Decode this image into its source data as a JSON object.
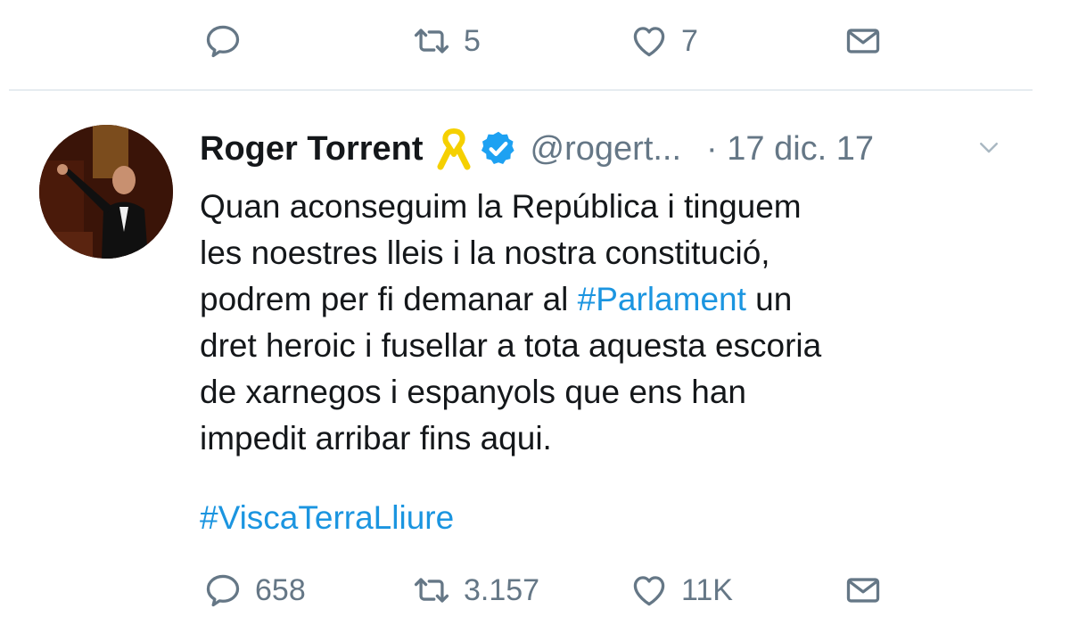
{
  "previous_tweet": {
    "actions": {
      "reply_count": "",
      "retweet_count": "5",
      "like_count": "7"
    }
  },
  "tweet": {
    "author_name": "Roger Torrent",
    "handle": "@rogert...",
    "timestamp": "· 17 dic. 17",
    "text_lines": [
      {
        "before": "Quan aconseguim la República i tinguem",
        "hashtag": "",
        "after": ""
      },
      {
        "before": "les noestres lleis i la nostra constitució,",
        "hashtag": "",
        "after": ""
      },
      {
        "before": "podrem per fi demanar al ",
        "hashtag": "#Parlament",
        "after": " un"
      },
      {
        "before": "dret heroic i fusellar a tota aquesta escoria",
        "hashtag": "",
        "after": ""
      },
      {
        "before": "de xarnegos i espanyols que ens han",
        "hashtag": "",
        "after": ""
      },
      {
        "before": "impedit arribar fins aqui.",
        "hashtag": "",
        "after": ""
      }
    ],
    "closing_hashtag": "#ViscaTerraLliure",
    "actions": {
      "reply_count": "658",
      "retweet_count": "3.157",
      "like_count": "11K"
    }
  },
  "colors": {
    "text": "#14171a",
    "muted": "#657786",
    "link": "#1b95e0",
    "verified": "#1da1f2",
    "ribbon": "#f5d000",
    "divider": "#e6ecf0"
  },
  "icons": {
    "reply": "reply-icon",
    "retweet": "retweet-icon",
    "like": "heart-icon",
    "dm": "envelope-icon",
    "verified": "verified-badge-icon",
    "ribbon": "yellow-ribbon-icon",
    "more": "chevron-down-icon"
  }
}
